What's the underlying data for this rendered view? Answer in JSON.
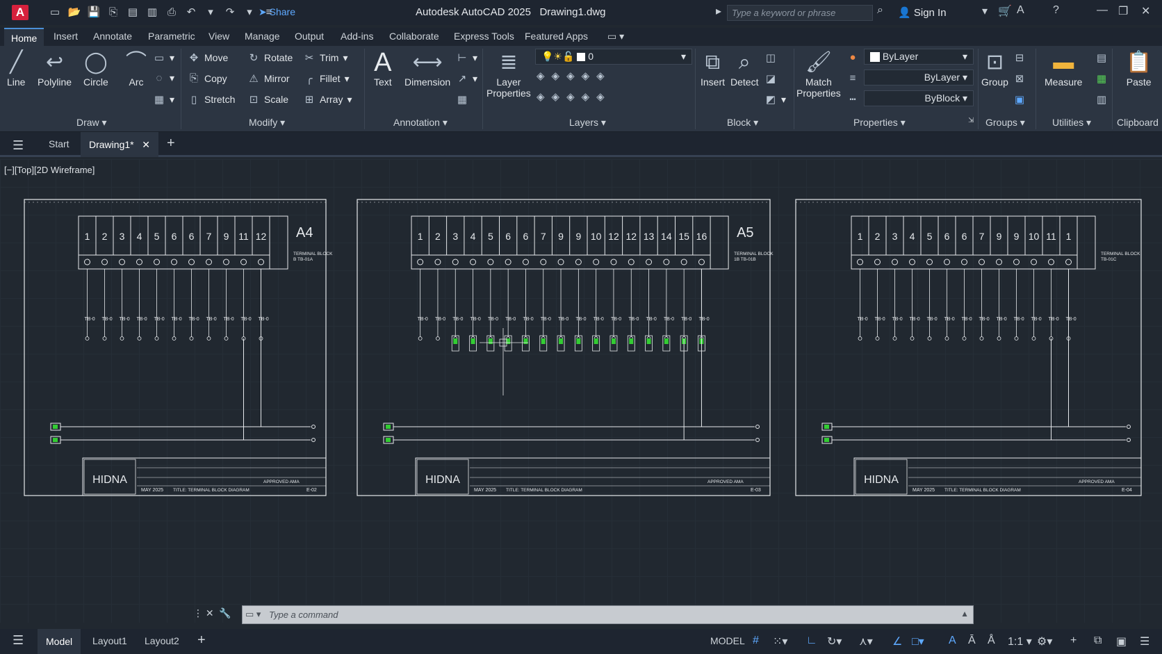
{
  "title": {
    "app_logo": "A",
    "share": "Share",
    "window_title": "Autodesk AutoCAD 2025",
    "file_name": "Drawing1.dwg",
    "search_placeholder": "Type a keyword or phrase",
    "sign_in": "Sign In"
  },
  "ribbon_tabs": [
    "Home",
    "Insert",
    "Annotate",
    "Parametric",
    "View",
    "Manage",
    "Output",
    "Add-ins",
    "Collaborate",
    "Express Tools",
    "Featured Apps"
  ],
  "draw": {
    "line": "Line",
    "polyline": "Polyline",
    "circle": "Circle",
    "arc": "Arc",
    "panel": "Draw"
  },
  "modify": {
    "move": "Move",
    "rotate": "Rotate",
    "trim": "Trim",
    "copy": "Copy",
    "mirror": "Mirror",
    "fillet": "Fillet",
    "stretch": "Stretch",
    "scale": "Scale",
    "array": "Array",
    "panel": "Modify"
  },
  "annotation": {
    "text": "Text",
    "dimension": "Dimension",
    "panel": "Annotation"
  },
  "layers": {
    "layer_props_1": "Layer",
    "layer_props_2": "Properties",
    "current_layer": "0",
    "panel": "Layers"
  },
  "block": {
    "insert": "Insert",
    "detect": "Detect",
    "panel": "Block"
  },
  "properties": {
    "match_1": "Match",
    "match_2": "Properties",
    "color": "ByLayer",
    "linetype": "ByLayer",
    "lineweight": "ByBlock",
    "panel": "Properties"
  },
  "groups": {
    "group": "Group",
    "panel": "Groups"
  },
  "utilities": {
    "measure": "Measure",
    "panel": "Utilities"
  },
  "clipboard": {
    "paste": "Paste",
    "panel": "Clipboard"
  },
  "file_tabs": {
    "start": "Start",
    "drawing": "Drawing1*"
  },
  "viewport_label": "[−][Top][2D Wireframe]",
  "command_placeholder": "Type  a  command",
  "status": {
    "model": "Model",
    "layout1": "Layout1",
    "layout2": "Layout2",
    "model_space": "MODEL",
    "scale": "1:1"
  },
  "sheets": [
    {
      "id": "A4",
      "terminals": [
        "1",
        "2",
        "3",
        "4",
        "5",
        "6",
        "6",
        "7",
        "9",
        "11",
        "12"
      ],
      "block_label": "TERMINAL BLOCK B TB-01A",
      "sheet_no": "E-02",
      "date": "MAY 2025",
      "title": "TITLE: TERMINAL BLOCK DIAGRAM",
      "approved": "APPROVED  AMA"
    },
    {
      "id": "A5",
      "terminals": [
        "1",
        "2",
        "3",
        "4",
        "5",
        "6",
        "6",
        "7",
        "9",
        "9",
        "10",
        "12",
        "12",
        "13",
        "14",
        "15",
        "16"
      ],
      "block_label": "TERMINAL BLOCK 1B TB-01B",
      "sheet_no": "E-03",
      "date": "MAY 2025",
      "title": "TITLE: TERMINAL BLOCK DIAGRAM",
      "approved": "APPROVED  AMA"
    },
    {
      "id": "",
      "terminals": [
        "1",
        "2",
        "3",
        "4",
        "5",
        "6",
        "6",
        "7",
        "9",
        "9",
        "10",
        "11",
        "1"
      ],
      "block_label": "TERMINAL BLOCK TB-01C",
      "sheet_no": "E-04",
      "date": "MAY 2025",
      "title": "TITLE: TERMINAL BLOCK DIAGRAM",
      "approved": "APPROVED  AMA"
    }
  ]
}
